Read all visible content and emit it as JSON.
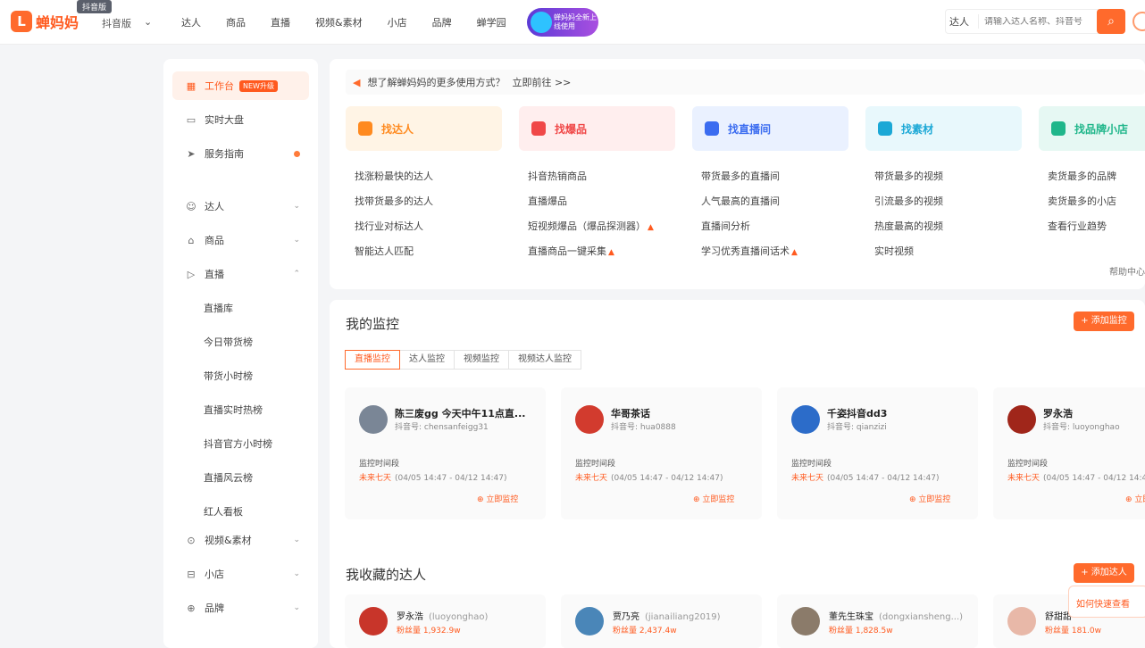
{
  "header": {
    "logo_text": "蝉妈妈",
    "platform_badge": "抖音版",
    "platform": "抖音版",
    "nav": [
      "达人",
      "商品",
      "直播",
      "视频&素材",
      "小店",
      "品牌",
      "蝉学园"
    ],
    "promo_text": "蝉妈妈全新上线使用",
    "search_type": "达人",
    "search_placeholder": "请输入达人名称、抖音号"
  },
  "sidebar": {
    "top_items": [
      {
        "label": "工作台",
        "badge": "NEW升级",
        "icon": "workbench-icon"
      },
      {
        "label": "实时大盘",
        "icon": "monitor-icon"
      },
      {
        "label": "服务指南",
        "icon": "send-icon"
      }
    ],
    "groups": [
      {
        "label": "达人",
        "icon": "user-icon"
      },
      {
        "label": "商品",
        "icon": "bag-icon"
      },
      {
        "label": "直播",
        "icon": "live-icon"
      }
    ],
    "live_sub": [
      "直播库",
      "今日带货榜",
      "带货小时榜",
      "直播实时热榜",
      "抖音官方小时榜",
      "直播风云榜",
      "红人看板"
    ],
    "bottom_groups": [
      {
        "label": "视频&素材",
        "icon": "video-icon"
      },
      {
        "label": "小店",
        "icon": "shop-icon"
      },
      {
        "label": "品牌",
        "icon": "brand-icon"
      }
    ]
  },
  "notice": {
    "text": "想了解蝉妈妈的更多使用方式？",
    "link": "立即前往 >>"
  },
  "cards": [
    {
      "title": "找达人",
      "bg": "#fff4e5",
      "color": "#ff8a1f",
      "icon": "star-icon"
    },
    {
      "title": "找爆品",
      "bg": "#ffeeee",
      "color": "#f04848",
      "icon": "bag-icon"
    },
    {
      "title": "找直播间",
      "bg": "#eaf1ff",
      "color": "#3b6cf0",
      "icon": "tv-icon"
    },
    {
      "title": "找素材",
      "bg": "#e8f8fc",
      "color": "#1ba8d6",
      "icon": "material-icon"
    },
    {
      "title": "找品牌小店",
      "bg": "#e6f8f3",
      "color": "#1fb68a",
      "icon": "store-icon"
    }
  ],
  "links": [
    [
      "找涨粉最快的达人",
      "找带货最多的达人",
      "找行业对标达人",
      "智能达人匹配"
    ],
    [
      "抖音热销商品",
      "直播爆品",
      "短视频爆品（爆品探测器）",
      "直播商品一键采集"
    ],
    [
      "带货最多的直播间",
      "人气最高的直播间",
      "直播间分析",
      "学习优秀直播间话术"
    ],
    [
      "带货最多的视频",
      "引流最多的视频",
      "热度最高的视频",
      "实时视频"
    ],
    [
      "卖货最多的品牌",
      "卖货最多的小店",
      "查看行业趋势"
    ]
  ],
  "hot_links": [
    [],
    [
      2,
      3
    ],
    [
      3
    ],
    [],
    []
  ],
  "help_center": "帮助中心",
  "monitor": {
    "title": "我的监控",
    "add_label": "+ 添加监控",
    "tabs": [
      "直播监控",
      "达人监控",
      "视频监控",
      "视频达人监控"
    ],
    "label": "监控时间段",
    "status": "未来七天",
    "time": "(04/05 14:47 - 04/12 14:47)",
    "action": "立即监控",
    "items": [
      {
        "name": "陈三废gg 今天中午11点直...",
        "handle": "抖音号: chensanfeigg31",
        "avatar": "#7a8696"
      },
      {
        "name": "华哥茶话",
        "handle": "抖音号: hua0888",
        "avatar": "#d23b2e"
      },
      {
        "name": "千姿抖音dd3",
        "handle": "抖音号: qianzizi",
        "avatar": "#2c6cc9"
      },
      {
        "name": "罗永浩",
        "handle": "抖音号: luoyonghao",
        "avatar": "#a0261a"
      }
    ]
  },
  "favorites": {
    "title": "我收藏的达人",
    "add_label": "+ 添加达人",
    "items": [
      {
        "name": "罗永浩",
        "handle": "(luoyonghao)",
        "fans": "粉丝量 1,932.9w",
        "avatar": "#c8352a"
      },
      {
        "name": "贾乃亮",
        "handle": "(jianailiang2019)",
        "fans": "粉丝量 2,437.4w",
        "avatar": "#4a86b8"
      },
      {
        "name": "董先生珠宝",
        "handle": "(dongxiansheng...)",
        "fans": "粉丝量 1,828.5w",
        "avatar": "#8b7b6a"
      },
      {
        "name": "舒甜甜",
        "handle": "",
        "fans": "粉丝量 181.0w",
        "avatar": "#e8b8a8"
      }
    ]
  },
  "float_tip": "如何快速查看"
}
